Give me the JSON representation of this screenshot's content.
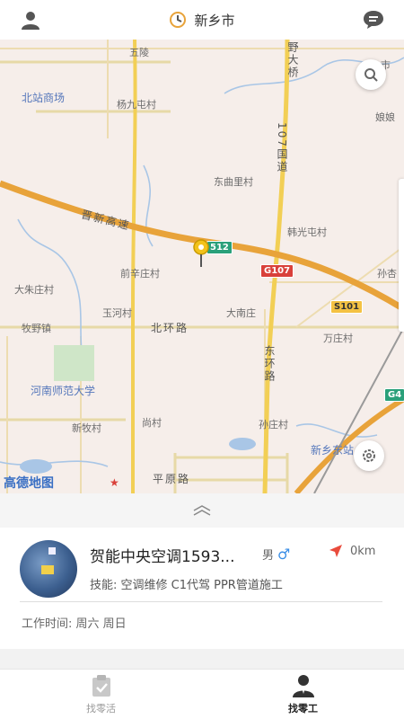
{
  "header": {
    "city": "新乡市",
    "left_icon": "user-icon",
    "right_icon": "chat-icon"
  },
  "map": {
    "places": {
      "wuling": "五陵",
      "yedaqiao": "野大桥",
      "beizhan": "北站商场",
      "yangjiutun": "杨九屯村",
      "niangniang": "娘娘",
      "dongqu": "东曲里村",
      "hanguangtun": "韩光屯村",
      "qianxin": "前辛庄村",
      "dazhu": "大朱庄村",
      "yuhe": "玉河村",
      "danan": "大南庄",
      "muye": "牧野镇",
      "wanzhuang": "万庄村",
      "henan_normal": "河南师范大学",
      "xinmu": "新牧村",
      "shangcun": "尚村",
      "sunzhuang": "孙庄村",
      "xinxiang_east": "新乡东站",
      "sun_edge": "孙杏",
      "shi_edge": "市"
    },
    "roads": {
      "jinxin": "晋新高速",
      "beihuan": "北环路",
      "donghuan": "东环路",
      "pingyuan": "平原路",
      "guodao107": "107国道"
    },
    "shields": {
      "s512": "512",
      "g107": "G107",
      "s101": "S101",
      "g4": "G4"
    },
    "logo": "高德地图"
  },
  "worker": {
    "name": "贺能中央空调1593...",
    "gender_label": "男",
    "gender_symbol": "♂",
    "distance": "0km",
    "skills": "技能: 空调维修 C1代驾 PPR管道施工",
    "work_time": "工作时间: 周六 周日"
  },
  "tabs": [
    {
      "label": "找零活",
      "icon": "clipboard-check-icon",
      "active": false
    },
    {
      "label": "找零工",
      "icon": "worker-icon",
      "active": true
    }
  ],
  "colors": {
    "accent": "#e94b3c",
    "blue": "#3a8ee6",
    "map_bg": "#f6eeea",
    "highway": "#e8a33a"
  }
}
